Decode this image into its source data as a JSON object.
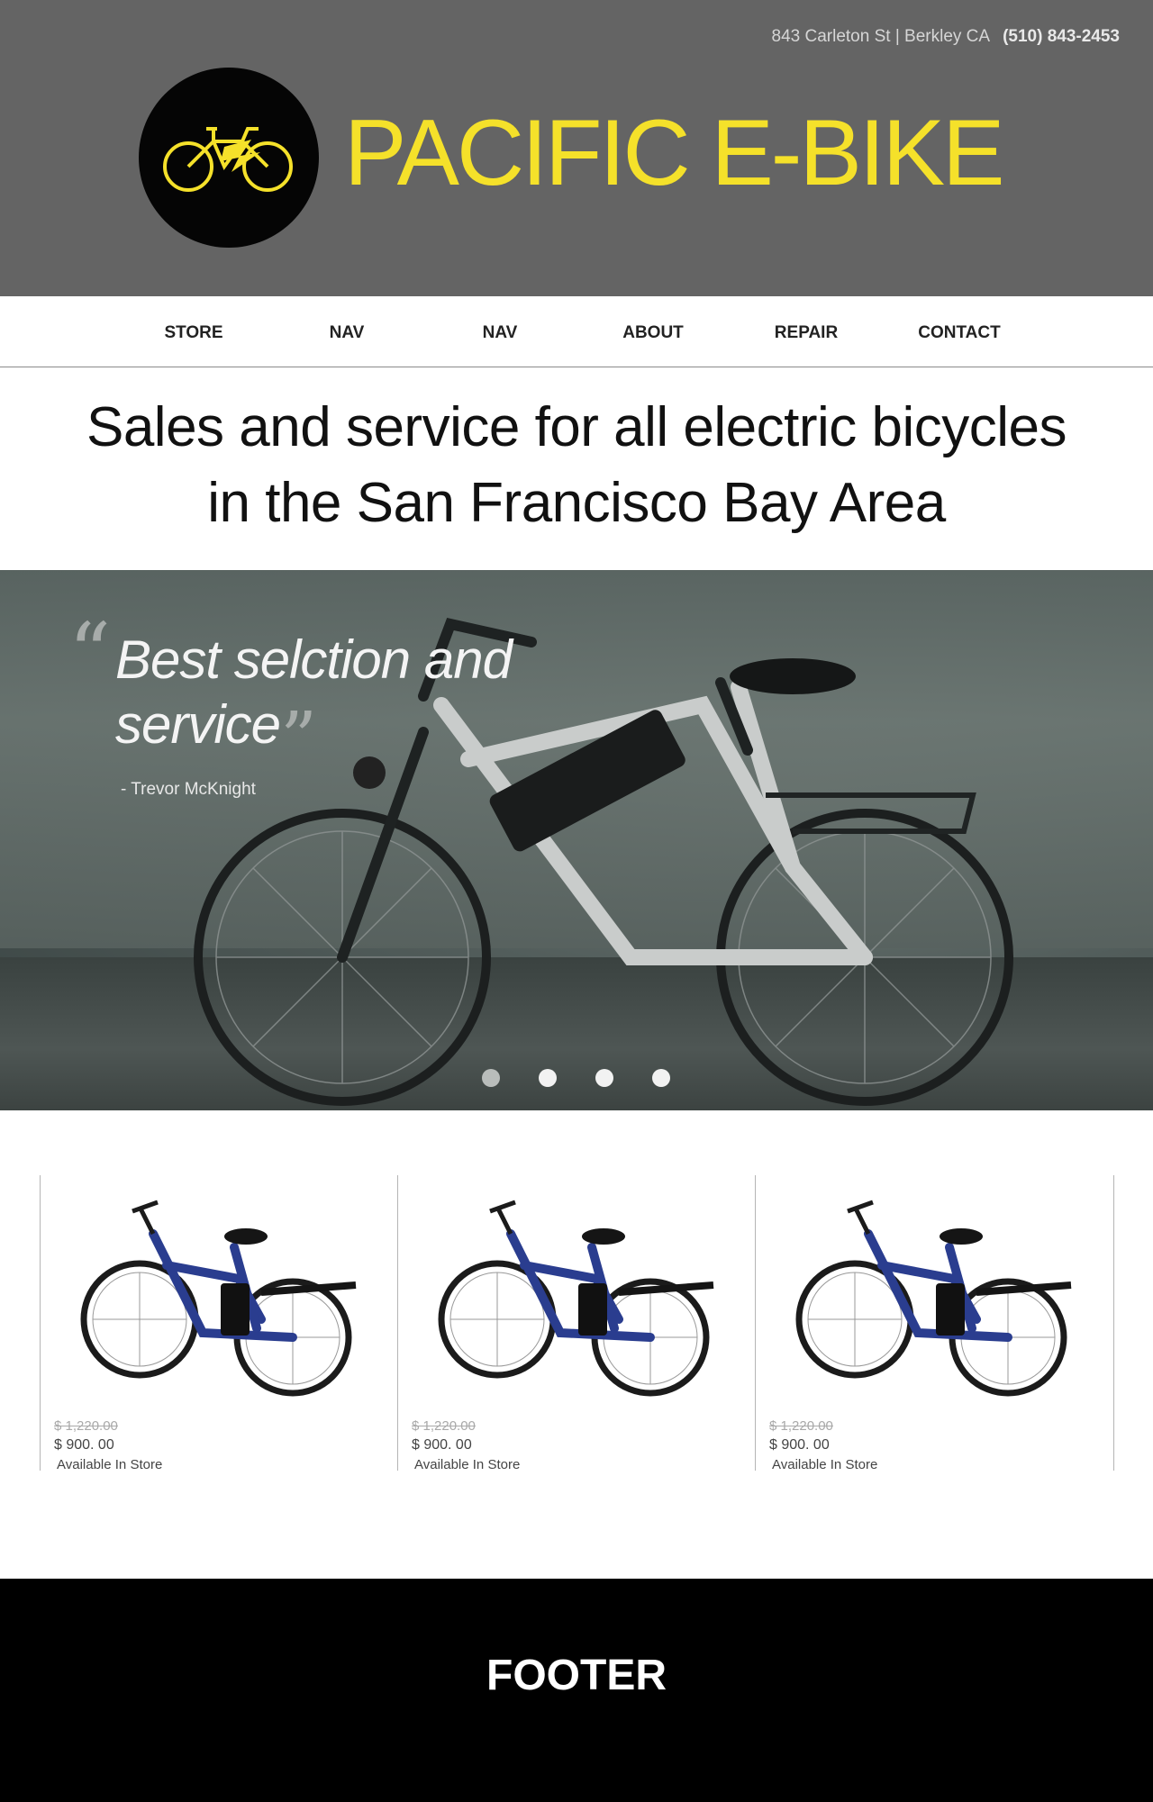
{
  "header": {
    "address": "843 Carleton St | Berkley CA",
    "phone": "(510) 843-2453",
    "brand": "PACIFIC E-BIKE",
    "logo_icon": "electric-bike-icon",
    "colors": {
      "background": "#646464",
      "brand": "#f5e12a",
      "logo_bg": "#050505"
    }
  },
  "nav": {
    "items": [
      {
        "label": "STORE"
      },
      {
        "label": "NAV"
      },
      {
        "label": "NAV"
      },
      {
        "label": "ABOUT"
      },
      {
        "label": "REPAIR"
      },
      {
        "label": "CONTACT"
      }
    ]
  },
  "tagline": {
    "line1": "Sales and service for all electric bicycles",
    "line2": "in the San Francisco Bay Area"
  },
  "hero": {
    "quote": "Best selction and service",
    "author": "- Trevor McKnight",
    "slide_count": 4,
    "active_slide": 2
  },
  "products": [
    {
      "old_price": "$ 1,220.00",
      "price": "$ 900. 00",
      "availability": "Available In Store"
    },
    {
      "old_price": "$ 1,220.00",
      "price": "$ 900. 00",
      "availability": "Available In Store"
    },
    {
      "old_price": "$ 1,220.00",
      "price": "$ 900. 00",
      "availability": "Available In Store"
    }
  ],
  "footer": {
    "label": "FOOTER",
    "background": "#000000"
  }
}
